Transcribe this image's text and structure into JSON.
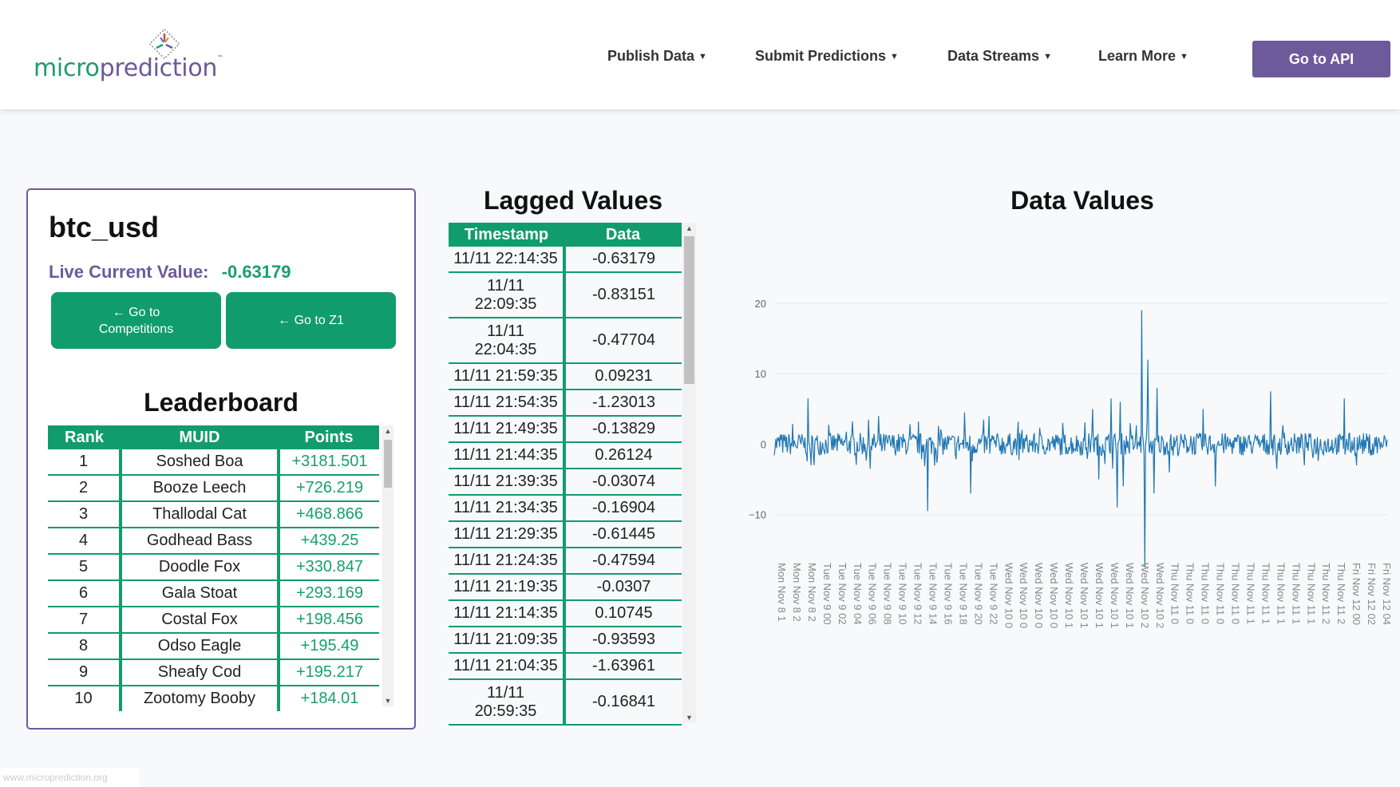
{
  "header": {
    "logo": {
      "part1": "micro",
      "part2": "prediction",
      "tm": "™"
    },
    "nav": [
      {
        "label": "Publish Data"
      },
      {
        "label": "Submit Predictions"
      },
      {
        "label": "Data Streams"
      },
      {
        "label": "Learn More"
      }
    ],
    "api_button": "Go to API"
  },
  "stream": {
    "name": "btc_usd",
    "live_label": "Live Current Value:",
    "live_value": "-0.63179",
    "buttons": {
      "competitions": "← Go to Competitions",
      "z1": "← Go to Z1"
    }
  },
  "leaderboard": {
    "title": "Leaderboard",
    "columns": [
      "Rank",
      "MUID",
      "Points"
    ],
    "rows": [
      {
        "rank": "1",
        "muid": "Soshed Boa",
        "points": "+3181.501"
      },
      {
        "rank": "2",
        "muid": "Booze Leech",
        "points": "+726.219"
      },
      {
        "rank": "3",
        "muid": "Thallodal Cat",
        "points": "+468.866"
      },
      {
        "rank": "4",
        "muid": "Godhead Bass",
        "points": "+439.25"
      },
      {
        "rank": "5",
        "muid": "Doodle Fox",
        "points": "+330.847"
      },
      {
        "rank": "6",
        "muid": "Gala Stoat",
        "points": "+293.169"
      },
      {
        "rank": "7",
        "muid": "Costal Fox",
        "points": "+198.456"
      },
      {
        "rank": "8",
        "muid": "Odso Eagle",
        "points": "+195.49"
      },
      {
        "rank": "9",
        "muid": "Sheafy Cod",
        "points": "+195.217"
      },
      {
        "rank": "10",
        "muid": "Zootomy Booby",
        "points": "+184.01"
      }
    ]
  },
  "lagged": {
    "title": "Lagged Values",
    "columns": [
      "Timestamp",
      "Data"
    ],
    "rows": [
      {
        "ts": "11/11 22:14:35",
        "data": "-0.63179"
      },
      {
        "ts": "11/11 22:09:35",
        "data": "-0.83151",
        "wrap": true
      },
      {
        "ts": "11/11 22:04:35",
        "data": "-0.47704",
        "wrap": true
      },
      {
        "ts": "11/11 21:59:35",
        "data": "0.09231"
      },
      {
        "ts": "11/11 21:54:35",
        "data": "-1.23013"
      },
      {
        "ts": "11/11 21:49:35",
        "data": "-0.13829"
      },
      {
        "ts": "11/11 21:44:35",
        "data": "0.26124"
      },
      {
        "ts": "11/11 21:39:35",
        "data": "-0.03074"
      },
      {
        "ts": "11/11 21:34:35",
        "data": "-0.16904"
      },
      {
        "ts": "11/11 21:29:35",
        "data": "-0.61445"
      },
      {
        "ts": "11/11 21:24:35",
        "data": "-0.47594"
      },
      {
        "ts": "11/11 21:19:35",
        "data": "-0.0307"
      },
      {
        "ts": "11/11 21:14:35",
        "data": "0.10745"
      },
      {
        "ts": "11/11 21:09:35",
        "data": "-0.93593"
      },
      {
        "ts": "11/11 21:04:35",
        "data": "-1.63961"
      },
      {
        "ts": "11/11 20:59:35",
        "data": "-0.16841",
        "wrap": true
      }
    ]
  },
  "chart_data": {
    "type": "line",
    "title": "Data Values",
    "xlabel": "",
    "ylabel": "",
    "ylim": [
      -14,
      20
    ],
    "yticks": [
      "20",
      "10",
      "0",
      "−10"
    ],
    "ytick_values": [
      20,
      10,
      0,
      -10
    ],
    "grid": true,
    "color": "#1f77b4",
    "xtick_labels": [
      "Mon Nov 8 1",
      "Mon Nov 8 2",
      "Mon Nov 8 2",
      "Tue Nov 9 00",
      "Tue Nov 9 02",
      "Tue Nov 9 04",
      "Tue Nov 9 06",
      "Tue Nov 9 08",
      "Tue Nov 9 10",
      "Tue Nov 9 12",
      "Tue Nov 9 14",
      "Tue Nov 9 16",
      "Tue Nov 9 18",
      "Tue Nov 9 20",
      "Tue Nov 9 22",
      "Wed Nov 10 0",
      "Wed Nov 10 0",
      "Wed Nov 10 0",
      "Wed Nov 10 0",
      "Wed Nov 10 1",
      "Wed Nov 10 1",
      "Wed Nov 10 1",
      "Wed Nov 10 1",
      "Wed Nov 10 1",
      "Wed Nov 10 2",
      "Wed Nov 10 2",
      "Thu Nov 11 0",
      "Thu Nov 11 0",
      "Thu Nov 11 0",
      "Thu Nov 11 0",
      "Thu Nov 11 0",
      "Thu Nov 11 1",
      "Thu Nov 11 1",
      "Thu Nov 11 1",
      "Thu Nov 11 1",
      "Thu Nov 11 1",
      "Thu Nov 11 2",
      "Thu Nov 11 2",
      "Fri Nov 12 00",
      "Fri Nov 12 02",
      "Fri Nov 12 04"
    ],
    "spikes": [
      {
        "i": 0.055,
        "v": 6.5
      },
      {
        "i": 0.06,
        "v": -3
      },
      {
        "i": 0.25,
        "v": -9.5
      },
      {
        "i": 0.32,
        "v": -7
      },
      {
        "i": 0.31,
        "v": 4.5
      },
      {
        "i": 0.52,
        "v": 5
      },
      {
        "i": 0.53,
        "v": -5
      },
      {
        "i": 0.55,
        "v": 6.5
      },
      {
        "i": 0.56,
        "v": -9
      },
      {
        "i": 0.565,
        "v": 6
      },
      {
        "i": 0.57,
        "v": -6
      },
      {
        "i": 0.6,
        "v": 19
      },
      {
        "i": 0.605,
        "v": -17.5
      },
      {
        "i": 0.61,
        "v": 12
      },
      {
        "i": 0.62,
        "v": -7
      },
      {
        "i": 0.625,
        "v": 8
      },
      {
        "i": 0.645,
        "v": -4
      },
      {
        "i": 0.7,
        "v": 5
      },
      {
        "i": 0.72,
        "v": -6
      },
      {
        "i": 0.81,
        "v": 7.5
      },
      {
        "i": 0.82,
        "v": -3.5
      },
      {
        "i": 0.93,
        "v": 6.5
      },
      {
        "i": 0.95,
        "v": -3
      },
      {
        "i": 0.35,
        "v": 4
      },
      {
        "i": 0.17,
        "v": 4
      }
    ]
  }
}
